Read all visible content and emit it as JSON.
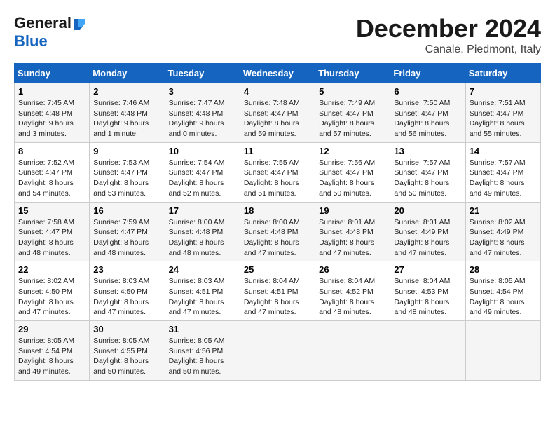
{
  "header": {
    "logo_line1": "General",
    "logo_line2": "Blue",
    "month": "December 2024",
    "location": "Canale, Piedmont, Italy"
  },
  "days_of_week": [
    "Sunday",
    "Monday",
    "Tuesday",
    "Wednesday",
    "Thursday",
    "Friday",
    "Saturday"
  ],
  "weeks": [
    [
      {
        "day": "1",
        "sunrise": "Sunrise: 7:45 AM",
        "sunset": "Sunset: 4:48 PM",
        "daylight": "Daylight: 9 hours and 3 minutes."
      },
      {
        "day": "2",
        "sunrise": "Sunrise: 7:46 AM",
        "sunset": "Sunset: 4:48 PM",
        "daylight": "Daylight: 9 hours and 1 minute."
      },
      {
        "day": "3",
        "sunrise": "Sunrise: 7:47 AM",
        "sunset": "Sunset: 4:48 PM",
        "daylight": "Daylight: 9 hours and 0 minutes."
      },
      {
        "day": "4",
        "sunrise": "Sunrise: 7:48 AM",
        "sunset": "Sunset: 4:47 PM",
        "daylight": "Daylight: 8 hours and 59 minutes."
      },
      {
        "day": "5",
        "sunrise": "Sunrise: 7:49 AM",
        "sunset": "Sunset: 4:47 PM",
        "daylight": "Daylight: 8 hours and 57 minutes."
      },
      {
        "day": "6",
        "sunrise": "Sunrise: 7:50 AM",
        "sunset": "Sunset: 4:47 PM",
        "daylight": "Daylight: 8 hours and 56 minutes."
      },
      {
        "day": "7",
        "sunrise": "Sunrise: 7:51 AM",
        "sunset": "Sunset: 4:47 PM",
        "daylight": "Daylight: 8 hours and 55 minutes."
      }
    ],
    [
      {
        "day": "8",
        "sunrise": "Sunrise: 7:52 AM",
        "sunset": "Sunset: 4:47 PM",
        "daylight": "Daylight: 8 hours and 54 minutes."
      },
      {
        "day": "9",
        "sunrise": "Sunrise: 7:53 AM",
        "sunset": "Sunset: 4:47 PM",
        "daylight": "Daylight: 8 hours and 53 minutes."
      },
      {
        "day": "10",
        "sunrise": "Sunrise: 7:54 AM",
        "sunset": "Sunset: 4:47 PM",
        "daylight": "Daylight: 8 hours and 52 minutes."
      },
      {
        "day": "11",
        "sunrise": "Sunrise: 7:55 AM",
        "sunset": "Sunset: 4:47 PM",
        "daylight": "Daylight: 8 hours and 51 minutes."
      },
      {
        "day": "12",
        "sunrise": "Sunrise: 7:56 AM",
        "sunset": "Sunset: 4:47 PM",
        "daylight": "Daylight: 8 hours and 50 minutes."
      },
      {
        "day": "13",
        "sunrise": "Sunrise: 7:57 AM",
        "sunset": "Sunset: 4:47 PM",
        "daylight": "Daylight: 8 hours and 50 minutes."
      },
      {
        "day": "14",
        "sunrise": "Sunrise: 7:57 AM",
        "sunset": "Sunset: 4:47 PM",
        "daylight": "Daylight: 8 hours and 49 minutes."
      }
    ],
    [
      {
        "day": "15",
        "sunrise": "Sunrise: 7:58 AM",
        "sunset": "Sunset: 4:47 PM",
        "daylight": "Daylight: 8 hours and 48 minutes."
      },
      {
        "day": "16",
        "sunrise": "Sunrise: 7:59 AM",
        "sunset": "Sunset: 4:47 PM",
        "daylight": "Daylight: 8 hours and 48 minutes."
      },
      {
        "day": "17",
        "sunrise": "Sunrise: 8:00 AM",
        "sunset": "Sunset: 4:48 PM",
        "daylight": "Daylight: 8 hours and 48 minutes."
      },
      {
        "day": "18",
        "sunrise": "Sunrise: 8:00 AM",
        "sunset": "Sunset: 4:48 PM",
        "daylight": "Daylight: 8 hours and 47 minutes."
      },
      {
        "day": "19",
        "sunrise": "Sunrise: 8:01 AM",
        "sunset": "Sunset: 4:48 PM",
        "daylight": "Daylight: 8 hours and 47 minutes."
      },
      {
        "day": "20",
        "sunrise": "Sunrise: 8:01 AM",
        "sunset": "Sunset: 4:49 PM",
        "daylight": "Daylight: 8 hours and 47 minutes."
      },
      {
        "day": "21",
        "sunrise": "Sunrise: 8:02 AM",
        "sunset": "Sunset: 4:49 PM",
        "daylight": "Daylight: 8 hours and 47 minutes."
      }
    ],
    [
      {
        "day": "22",
        "sunrise": "Sunrise: 8:02 AM",
        "sunset": "Sunset: 4:50 PM",
        "daylight": "Daylight: 8 hours and 47 minutes."
      },
      {
        "day": "23",
        "sunrise": "Sunrise: 8:03 AM",
        "sunset": "Sunset: 4:50 PM",
        "daylight": "Daylight: 8 hours and 47 minutes."
      },
      {
        "day": "24",
        "sunrise": "Sunrise: 8:03 AM",
        "sunset": "Sunset: 4:51 PM",
        "daylight": "Daylight: 8 hours and 47 minutes."
      },
      {
        "day": "25",
        "sunrise": "Sunrise: 8:04 AM",
        "sunset": "Sunset: 4:51 PM",
        "daylight": "Daylight: 8 hours and 47 minutes."
      },
      {
        "day": "26",
        "sunrise": "Sunrise: 8:04 AM",
        "sunset": "Sunset: 4:52 PM",
        "daylight": "Daylight: 8 hours and 48 minutes."
      },
      {
        "day": "27",
        "sunrise": "Sunrise: 8:04 AM",
        "sunset": "Sunset: 4:53 PM",
        "daylight": "Daylight: 8 hours and 48 minutes."
      },
      {
        "day": "28",
        "sunrise": "Sunrise: 8:05 AM",
        "sunset": "Sunset: 4:54 PM",
        "daylight": "Daylight: 8 hours and 49 minutes."
      }
    ],
    [
      {
        "day": "29",
        "sunrise": "Sunrise: 8:05 AM",
        "sunset": "Sunset: 4:54 PM",
        "daylight": "Daylight: 8 hours and 49 minutes."
      },
      {
        "day": "30",
        "sunrise": "Sunrise: 8:05 AM",
        "sunset": "Sunset: 4:55 PM",
        "daylight": "Daylight: 8 hours and 50 minutes."
      },
      {
        "day": "31",
        "sunrise": "Sunrise: 8:05 AM",
        "sunset": "Sunset: 4:56 PM",
        "daylight": "Daylight: 8 hours and 50 minutes."
      },
      null,
      null,
      null,
      null
    ]
  ]
}
